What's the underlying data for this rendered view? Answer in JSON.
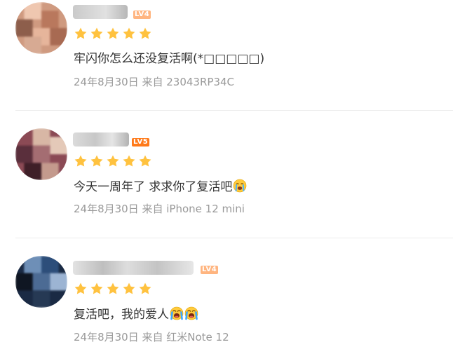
{
  "colors": {
    "star": "#FFC23F",
    "level_badge": "#FF7A1A",
    "text": "#333333",
    "meta": "#999999",
    "divider": "#EDEDED"
  },
  "comments": [
    {
      "level": "LV4",
      "rating": 5,
      "text": "牢闪你怎么还没复活啊(*□□□□□)",
      "meta": "24年8月30日 来自 23043RP34C",
      "avatar_colors": [
        "#d9a58a",
        "#b9785d",
        "#efc7b0",
        "#8d5e4b"
      ]
    },
    {
      "level": "LV5",
      "rating": 5,
      "text": "今天一周年了 求求你了复活吧",
      "emoji": "crying-face-emoji",
      "meta": "24年8月30日 来自 iPhone 12 mini",
      "avatar_colors": [
        "#8b4a55",
        "#5a2f3c",
        "#d8b7a5",
        "#a46d72"
      ]
    },
    {
      "level": "LV4",
      "rating": 5,
      "text": "复活吧，我的爱人",
      "emoji": "loudly-crying-emoji",
      "meta": "24年8月30日 来自 红米Note 12",
      "avatar_colors": [
        "#2d4e7a",
        "#1a2a44",
        "#6e8fb7",
        "#0f1622"
      ]
    }
  ]
}
